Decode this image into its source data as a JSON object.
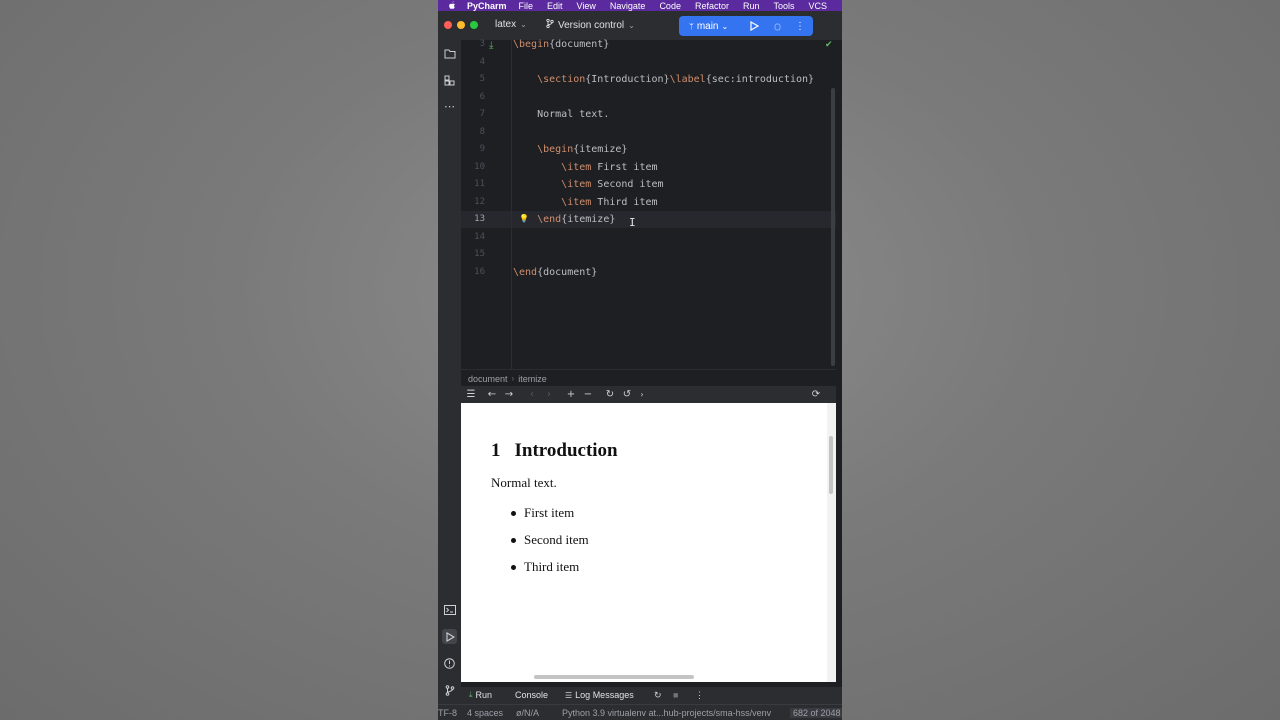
{
  "menubar": {
    "app": "PyCharm",
    "items": [
      "File",
      "Edit",
      "View",
      "Navigate",
      "Code",
      "Refactor",
      "Run",
      "Tools",
      "VCS"
    ]
  },
  "titlebar": {
    "project": "latex",
    "vcs_label": "Version control",
    "branch": "main"
  },
  "editor": {
    "lines": [
      {
        "num": "3",
        "tokens": [
          [
            "kw",
            "\\begin"
          ],
          [
            "br",
            "{document}"
          ]
        ]
      },
      {
        "num": "4",
        "tokens": []
      },
      {
        "num": "5",
        "tokens": [
          [
            "sp",
            "    "
          ],
          [
            "kw",
            "\\section"
          ],
          [
            "br",
            "{Introduction}"
          ],
          [
            "kw",
            "\\label"
          ],
          [
            "br",
            "{sec:introduction}"
          ]
        ]
      },
      {
        "num": "6",
        "tokens": []
      },
      {
        "num": "7",
        "tokens": [
          [
            "sp",
            "    "
          ],
          [
            "tx",
            "Normal text."
          ]
        ]
      },
      {
        "num": "8",
        "tokens": []
      },
      {
        "num": "9",
        "tokens": [
          [
            "sp",
            "    "
          ],
          [
            "kw",
            "\\begin"
          ],
          [
            "br",
            "{itemize}"
          ]
        ]
      },
      {
        "num": "10",
        "tokens": [
          [
            "sp",
            "        "
          ],
          [
            "kw",
            "\\item"
          ],
          [
            "tx",
            " First item"
          ]
        ]
      },
      {
        "num": "11",
        "tokens": [
          [
            "sp",
            "        "
          ],
          [
            "kw",
            "\\item"
          ],
          [
            "tx",
            " Second item"
          ]
        ]
      },
      {
        "num": "12",
        "tokens": [
          [
            "sp",
            "        "
          ],
          [
            "kw",
            "\\item"
          ],
          [
            "tx",
            " Third item"
          ]
        ]
      },
      {
        "num": "13",
        "tokens": [
          [
            "sp",
            "    "
          ],
          [
            "kw",
            "\\end"
          ],
          [
            "br",
            "{itemize}"
          ]
        ]
      },
      {
        "num": "14",
        "tokens": []
      },
      {
        "num": "15",
        "tokens": []
      },
      {
        "num": "16",
        "tokens": [
          [
            "kw",
            "\\end"
          ],
          [
            "br",
            "{document}"
          ]
        ]
      }
    ],
    "current_line": "13"
  },
  "breadcrumb": {
    "items": [
      "document",
      "itemize"
    ]
  },
  "preview": {
    "section_number": "1",
    "section_title": "Introduction",
    "paragraph": "Normal text.",
    "items": [
      "First item",
      "Second item",
      "Third item"
    ]
  },
  "bottom_tabs": {
    "run": "Run",
    "console": "Console",
    "log": "Log Messages"
  },
  "statusbar": {
    "encoding": "TF-8",
    "indent": "4 spaces",
    "vcs": "ø/N/A",
    "interpreter": "Python 3.9 virtualenv at...hub-projects/sma-hss/venv",
    "memory": "682 of 2048"
  },
  "colors": {
    "menubar": "#5a2a9e",
    "branch_button": "#3574f0",
    "keyword": "#cf8e6d",
    "editor_bg": "#1e1f22",
    "chrome_bg": "#2b2d30"
  }
}
